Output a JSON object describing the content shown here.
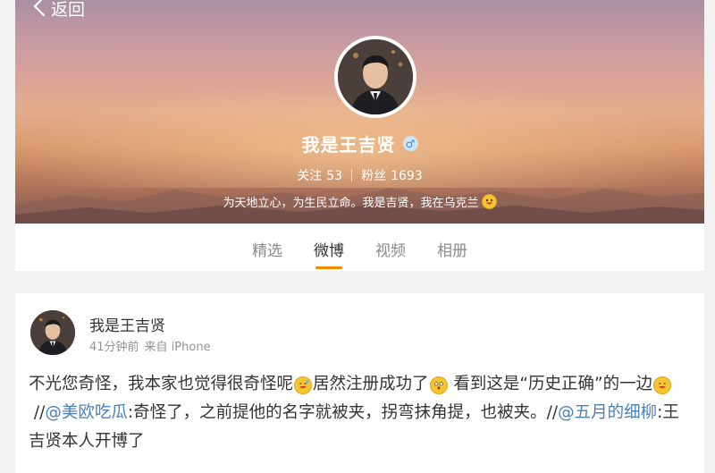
{
  "header": {
    "back_label": "返回"
  },
  "profile": {
    "name": "我是王吉贤",
    "gender_symbol": "♂",
    "following_label": "关注",
    "following_count": "53",
    "followers_label": "粉丝",
    "followers_count": "1693",
    "bio": "为天地立心，为生民立命。我是吉贤，我在乌克兰"
  },
  "tabs": [
    {
      "label": "精选",
      "active": false
    },
    {
      "label": "微博",
      "active": true
    },
    {
      "label": "视频",
      "active": false
    },
    {
      "label": "相册",
      "active": false
    }
  ],
  "post": {
    "author": "我是王吉贤",
    "time": "41分钟前",
    "source": "来自 iPhone",
    "text_1": "不光您奇怪，我本家也觉得很奇怪呢",
    "text_2": "居然注册成功了",
    "text_3": "看到这是“历史正确”的一边",
    "text_4": "//",
    "mention_1": "@美欧吃瓜",
    "text_5": ":奇怪了，之前提他的名字就被夹，拐弯抹角提，也被夹。//",
    "mention_2": "@五月的细柳",
    "text_6": ":王吉贤本人开博了"
  },
  "colors": {
    "accent": "#f78b00",
    "mention": "#4a7fb8",
    "background": "#f2f2f2"
  },
  "icons": {
    "back": "chevron-left-icon",
    "gender": "male-icon",
    "emoji_bio": "grin-emoji",
    "emoji_1": "sweat-smile-emoji",
    "emoji_2": "surprised-emoji",
    "emoji_3": "smile-emoji"
  }
}
